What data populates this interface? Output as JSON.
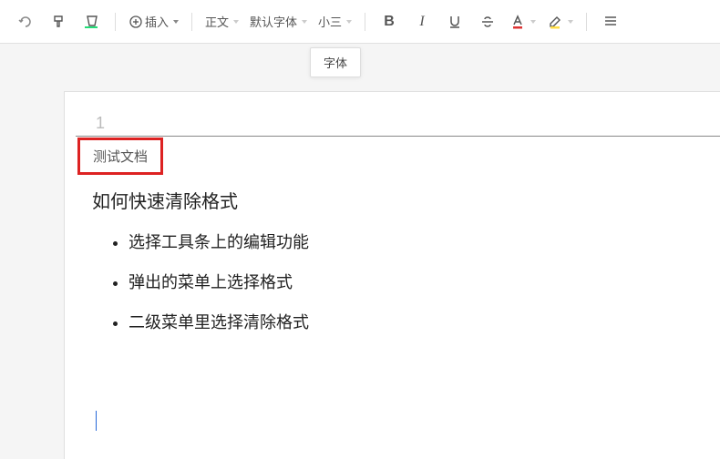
{
  "toolbar": {
    "insert_label": "插入",
    "style_label": "正文",
    "font_label": "默认字体",
    "size_label": "小三",
    "bold": "B",
    "italic": "I"
  },
  "tooltip": "字体",
  "page": {
    "number": "1",
    "doc_title": "测试文档",
    "heading": "如何快速清除格式",
    "bullets": [
      "选择工具条上的编辑功能",
      "弹出的菜单上选择格式",
      "二级菜单里选择清除格式"
    ]
  }
}
